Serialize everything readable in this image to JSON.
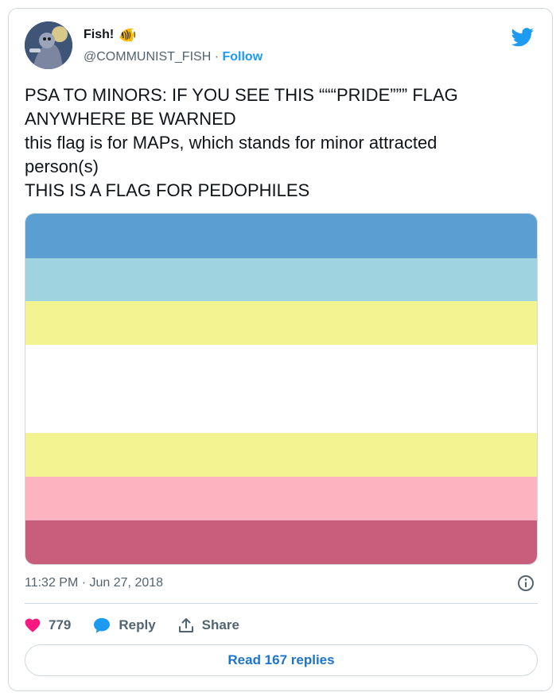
{
  "author": {
    "display_name": "Fish!",
    "emoji": "🐠",
    "handle": "@COMMUNIST_FISH",
    "separator": "·",
    "follow_label": "Follow"
  },
  "tweet": {
    "lines": [
      "PSA TO MINORS: IF YOU SEE THIS “““PRIDE””” FLAG",
      "ANYWHERE BE WARNED",
      "this flag is for MAPs, which stands for minor attracted",
      "person(s)",
      "THIS IS A FLAG FOR PEDOPHILES"
    ],
    "timestamp": "11:32 PM · Jun 27, 2018"
  },
  "flag": {
    "stripes": [
      {
        "color": "#5b9fd2",
        "weight": 56
      },
      {
        "color": "#9fd3df",
        "weight": 54
      },
      {
        "color": "#f3f392",
        "weight": 55
      },
      {
        "color": "#ffffff",
        "weight": 112
      },
      {
        "color": "#f3f392",
        "weight": 55
      },
      {
        "color": "#fdb4c0",
        "weight": 55
      },
      {
        "color": "#c95d7c",
        "weight": 56
      }
    ]
  },
  "actions": {
    "likes": "779",
    "reply_label": "Reply",
    "share_label": "Share",
    "read_replies_label": "Read 167 replies"
  },
  "colors": {
    "twitter_blue": "#1d9bf0",
    "like_pink": "#f91880",
    "muted": "#536471"
  }
}
